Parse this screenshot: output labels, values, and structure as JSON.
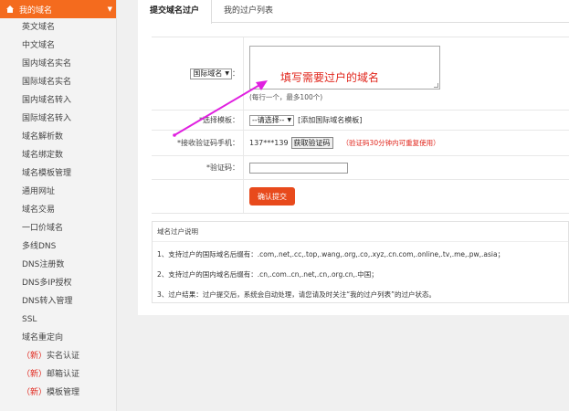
{
  "sidebar": {
    "header": "我的域名",
    "items": [
      {
        "label": "英文域名"
      },
      {
        "label": "中文域名"
      },
      {
        "label": "国内域名实名"
      },
      {
        "label": "国际域名实名"
      },
      {
        "label": "国内域名转入"
      },
      {
        "label": "国际域名转入"
      },
      {
        "label": "域名解析数"
      },
      {
        "label": "域名绑定数"
      },
      {
        "label": "域名模板管理"
      },
      {
        "label": "通用网址"
      },
      {
        "label": "域名交易"
      },
      {
        "label": "一口价域名"
      },
      {
        "label": "多线DNS"
      },
      {
        "label": "DNS注册数"
      },
      {
        "label": "DNS多IP授权"
      },
      {
        "label": "DNS转入管理"
      },
      {
        "label": "SSL"
      },
      {
        "label": "域名重定向"
      },
      {
        "tag": "（新）",
        "label": "实名认证"
      },
      {
        "tag": "（新）",
        "label": "邮箱认证"
      },
      {
        "tag": "（新）",
        "label": "模板管理"
      }
    ]
  },
  "tabs": [
    {
      "label": "提交域名过户"
    },
    {
      "label": "我的过户列表"
    }
  ],
  "form": {
    "domain_type_select": "国际域名",
    "domain_label_colon": "：",
    "domain_hint": "(每行一个，最多100个)",
    "template_label": "*选择模板：",
    "template_select": "--请选择--",
    "template_link": "[添加国际域名模板]",
    "phone_label": "*接收验证码手机：",
    "phone_value": "137***139",
    "get_code_btn": "获取验证码",
    "code_note": "（验证码30分钟内可重复使用）",
    "code_label": "*验证码：",
    "submit_btn": "确认提交"
  },
  "annotation": "填写需要过户的域名",
  "notes": {
    "title": "域名过户说明",
    "items": [
      "1、支持过户的国际域名后缀有：.com,.net,.cc,.top,.wang,.org,.co,.xyz,.cn.com,.online,.tv,.me,.pw,.asia；",
      "2、支持过户的国内域名后缀有：.cn,.com..cn,.net,.cn,.org.cn,.中国；",
      "3、过户结果：过户提交后，系统会自动处理，请您请及时关注“我的过户列表”的过户状态。"
    ]
  },
  "colors": {
    "accent": "#f46b1e",
    "red": "#e1261c",
    "arrow": "#e020e0"
  }
}
